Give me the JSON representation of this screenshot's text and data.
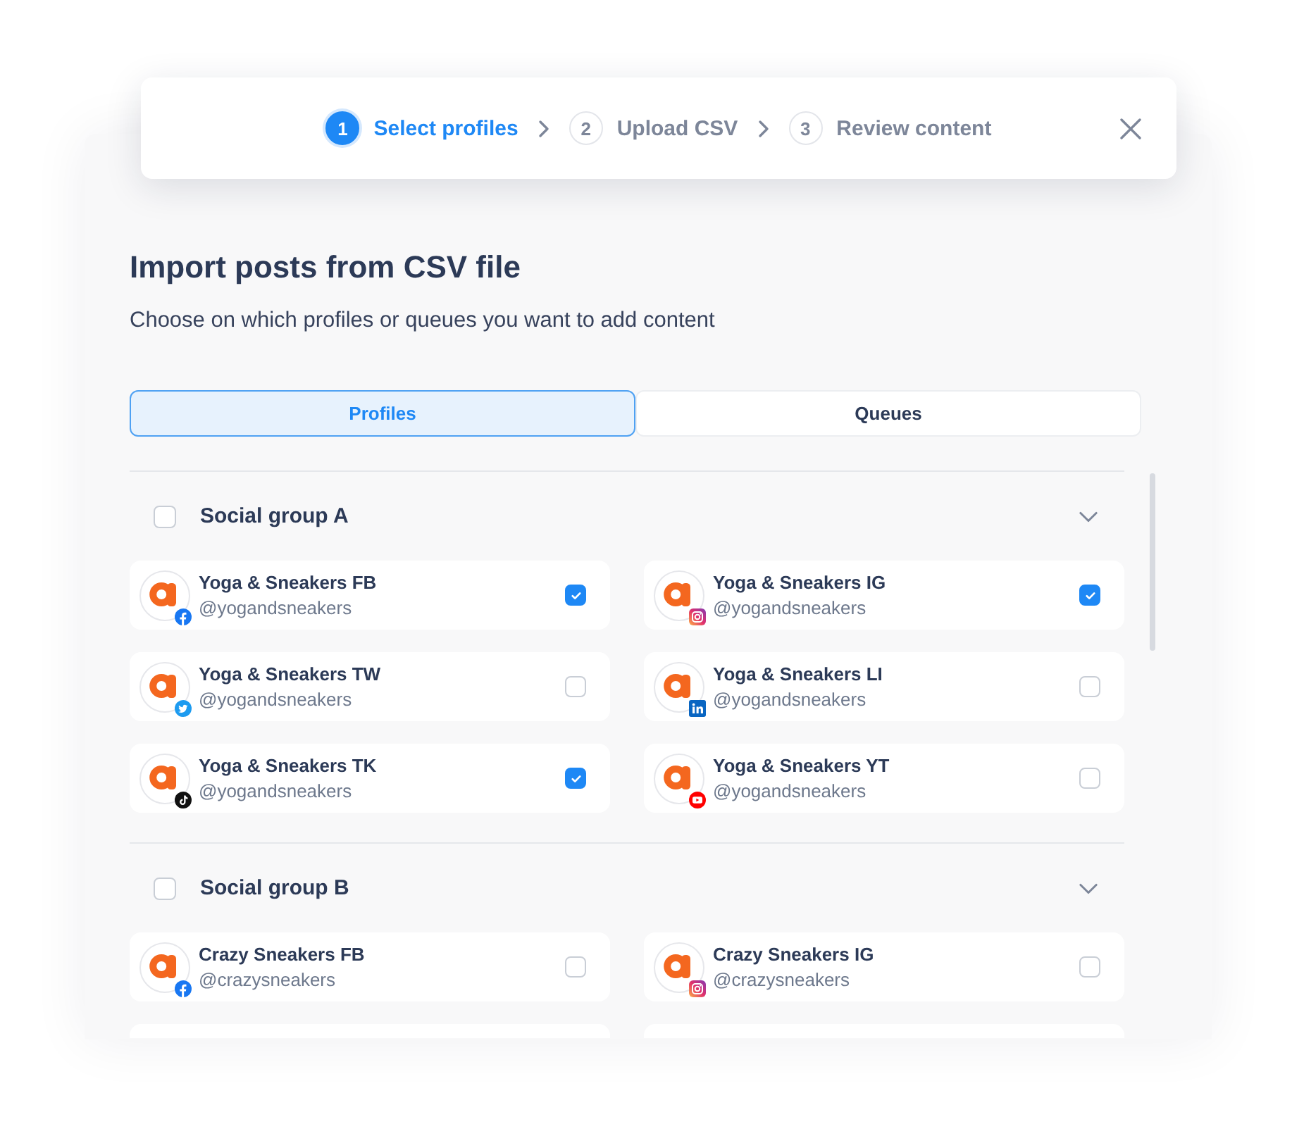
{
  "stepper": {
    "steps": [
      {
        "number": "1",
        "label": "Select profiles",
        "selected": true
      },
      {
        "number": "2",
        "label": "Upload CSV",
        "selected": false
      },
      {
        "number": "3",
        "label": "Review content",
        "selected": false
      }
    ]
  },
  "dialog": {
    "title": "Import posts from CSV file",
    "subtitle": "Choose on which profiles or queues you want to add content"
  },
  "tabs": [
    {
      "label": "Profiles",
      "selected": true
    },
    {
      "label": "Queues",
      "selected": false
    }
  ],
  "groups": [
    {
      "label": "Social group A",
      "checked": false,
      "expanded": true,
      "profiles": [
        {
          "kind": "facebook",
          "name": "Yoga & Sneakers FB",
          "handle": "@yogandsneakers",
          "checked": true
        },
        {
          "kind": "instagram",
          "name": "Yoga & Sneakers IG",
          "handle": "@yogandsneakers",
          "checked": true
        },
        {
          "kind": "twitter",
          "name": "Yoga & Sneakers TW",
          "handle": "@yogandsneakers",
          "checked": false
        },
        {
          "kind": "linkedin",
          "name": "Yoga & Sneakers LI",
          "handle": "@yogandsneakers",
          "checked": false
        },
        {
          "kind": "tiktok",
          "name": "Yoga & Sneakers TK",
          "handle": "@yogandsneakers",
          "checked": true
        },
        {
          "kind": "youtube",
          "name": "Yoga & Sneakers YT",
          "handle": "@yogandsneakers",
          "checked": false
        }
      ]
    },
    {
      "label": "Social group B",
      "checked": false,
      "expanded": true,
      "profiles": [
        {
          "kind": "facebook",
          "name": "Crazy Sneakers FB",
          "handle": "@crazysneakers",
          "checked": false
        },
        {
          "kind": "instagram",
          "name": "Crazy Sneakers IG",
          "handle": "@crazysneakers",
          "checked": false
        },
        {
          "kind": "partial"
        },
        {
          "kind": "partial"
        }
      ]
    }
  ]
}
